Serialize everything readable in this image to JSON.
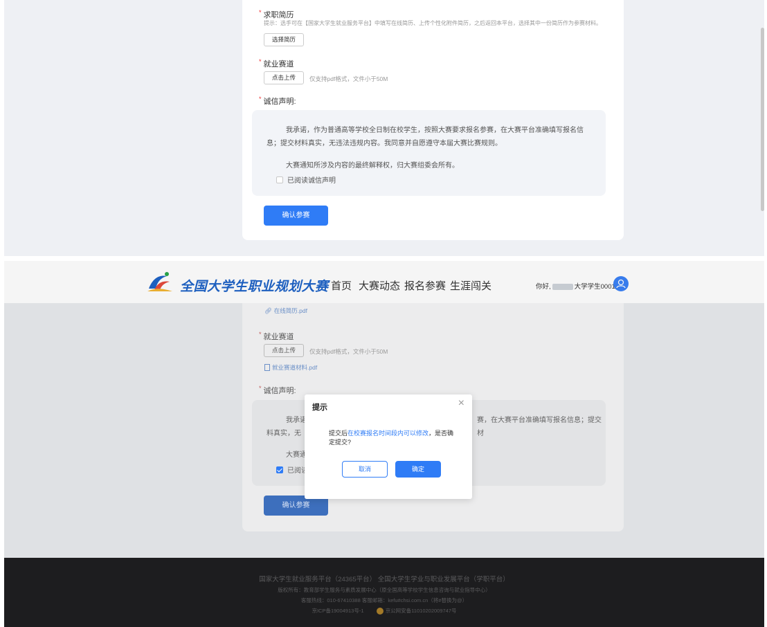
{
  "shot1": {
    "resume": {
      "label": "求职简历",
      "hint": "提示：选手可在【国家大学生就业服务平台】中填写在线简历、上传个性化附件简历，之后返回本平台，选择其中一份简历作为参赛材料。",
      "button": "选择简历"
    },
    "track": {
      "label": "就业赛道",
      "upload_button": "点击上传",
      "note": "仅支持pdf格式，文件小于50M"
    },
    "integrity": {
      "label": "诚信声明:",
      "para1": "我承诺，作为普通高等学校全日制在校学生，按照大赛要求报名参赛，在大赛平台准确填写报名信息；提交材料真实，无违法违规内容。我同意并自愿遵守本届大赛比赛规则。",
      "para2": "大赛通知所涉及内容的最终解释权，归大赛组委会所有。",
      "checkbox_label": "已阅读诚信声明",
      "checked": false
    },
    "submit_button": "确认参赛"
  },
  "shot2": {
    "header": {
      "brand": "全国大学生职业规划大赛",
      "nav": [
        "首页",
        "大赛动态",
        "报名参赛",
        "生涯闯关"
      ],
      "greeting_prefix": "你好,",
      "username": "大学学生0001"
    },
    "resume_file": "在线简历.pdf",
    "track": {
      "label": "就业赛道",
      "upload_button": "点击上传",
      "note": "仅支持pdf格式，文件小于50M",
      "file": "就业赛道材料.pdf"
    },
    "integrity": {
      "label": "诚信声明:",
      "para1_left": "我承诺",
      "para1_right": "赛，在大赛平台准确填写报名信息；提交材",
      "para2_left": "料真实，无",
      "para3_left": "大赛通",
      "checkbox_label": "已阅读",
      "checked": true
    },
    "submit_button": "确认参赛",
    "dialog": {
      "title": "提示",
      "close": "×",
      "body_prefix": "提交后",
      "body_highlight": "在校赛报名时间段内可以修改",
      "body_suffix": "，是否确定提交?",
      "cancel": "取消",
      "confirm": "确定"
    },
    "footer": {
      "line1": "国家大学生就业服务平台（24365平台）    全国大学生学业与职业发展平台（学职平台）",
      "line2": "版权所有：教育部学生服务与素质发展中心（原全国高等学校学生信息咨询与就业指导中心）",
      "line3": "客服热线：010-67410388    客服邮箱：kefu#chsi.com.cn（将#替换为@）",
      "line4a": "京ICP备19004913号-1",
      "line4b": "京公网安备11010202009747号"
    }
  },
  "colors": {
    "primary": "#2f7cf6",
    "brand_blue": "#1f63c7",
    "footer_bg": "#1d1d1f",
    "required": "#e33333"
  }
}
